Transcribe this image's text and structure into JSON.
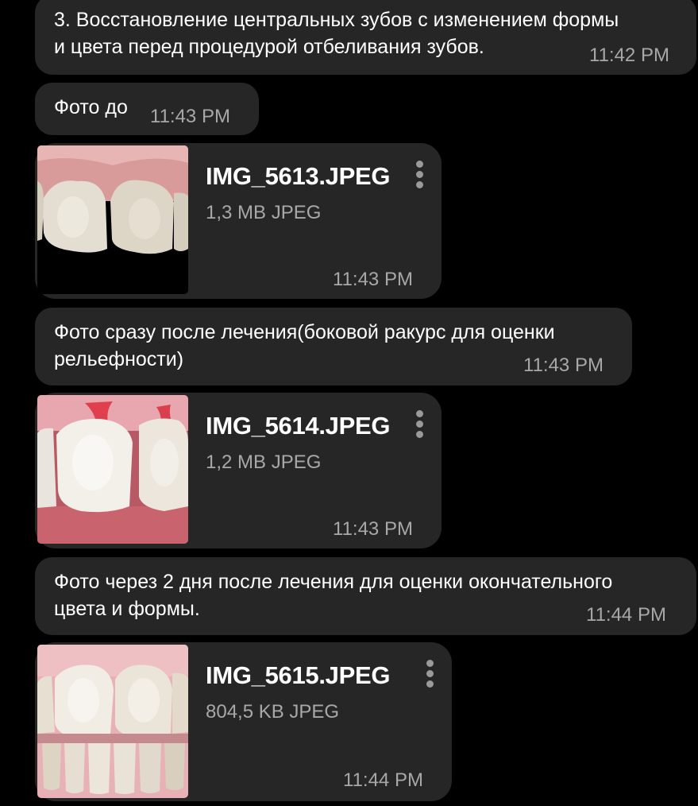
{
  "messages": [
    {
      "type": "text",
      "text": "3. Восстановление центральных зубов с изменением формы\nи цвета перед процедурой отбеливания зубов.",
      "time": "11:42 PM"
    },
    {
      "type": "text",
      "text": "Фото до",
      "time": "11:43 PM"
    },
    {
      "type": "file",
      "name": "IMG_5613.JPEG",
      "meta": "1,3 MB JPEG",
      "time": "11:43 PM",
      "thumb_icon": "teeth-before-photo"
    },
    {
      "type": "text",
      "text": "Фото сразу после лечения(боковой ракурс для оценки\nрельефности)",
      "time": "11:43 PM"
    },
    {
      "type": "file",
      "name": "IMG_5614.JPEG",
      "meta": "1,2 MB JPEG",
      "time": "11:43 PM",
      "thumb_icon": "teeth-after-side-photo"
    },
    {
      "type": "text",
      "text": "Фото через 2 дня после лечения для оценки окончательного\nцвета и формы.",
      "time": "11:44 PM"
    },
    {
      "type": "file",
      "name": "IMG_5615.JPEG",
      "meta": "804,5 KB JPEG",
      "time": "11:44 PM",
      "thumb_icon": "teeth-final-photo"
    }
  ],
  "colors": {
    "background": "#000000",
    "bubble": "#262626",
    "secondary_text": "#a8a8a8",
    "kebab": "#9a9a9a"
  }
}
